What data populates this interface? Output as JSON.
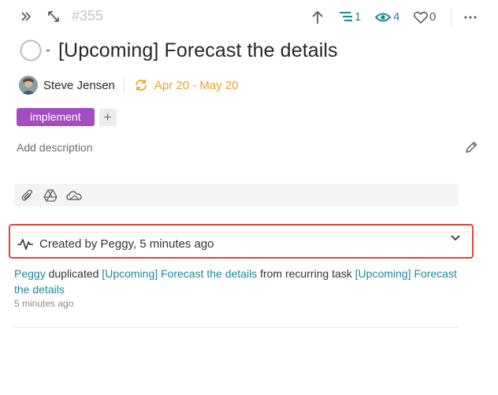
{
  "topbar": {
    "task_id": "#355",
    "subtasks_count": "1",
    "watchers_count": "4",
    "likes_count": "0"
  },
  "task": {
    "title": "[Upcoming] Forecast the details",
    "assignee": "Steve Jensen",
    "dates": "Apr 20 - May 20",
    "tags": [
      "implement"
    ],
    "add_tag_label": "+",
    "description_placeholder": "Add description"
  },
  "activity": {
    "header": "Created by Peggy, 5 minutes ago",
    "log": {
      "actor": "Peggy",
      "verb": " duplicated ",
      "target": "[Upcoming] Forecast the details",
      "middle": " from recurring task ",
      "source": "[Upcoming] Forecast the details",
      "time": "5 minutes ago"
    }
  },
  "colors": {
    "accent_teal": "#1a8a9a",
    "date_orange": "#f0a020",
    "tag_purple": "#a44dc0",
    "highlight_red": "#e0453a"
  },
  "icons": [
    "expand-panel-icon",
    "resize-icon",
    "arrow-up-icon",
    "subtasks-icon",
    "eye-icon",
    "heart-icon",
    "more-icon",
    "status-circle-icon",
    "caret-down-icon",
    "recurring-icon",
    "edit-pencil-icon",
    "paperclip-icon",
    "google-drive-icon",
    "onedrive-icon",
    "activity-pulse-icon",
    "chevron-down-icon"
  ]
}
